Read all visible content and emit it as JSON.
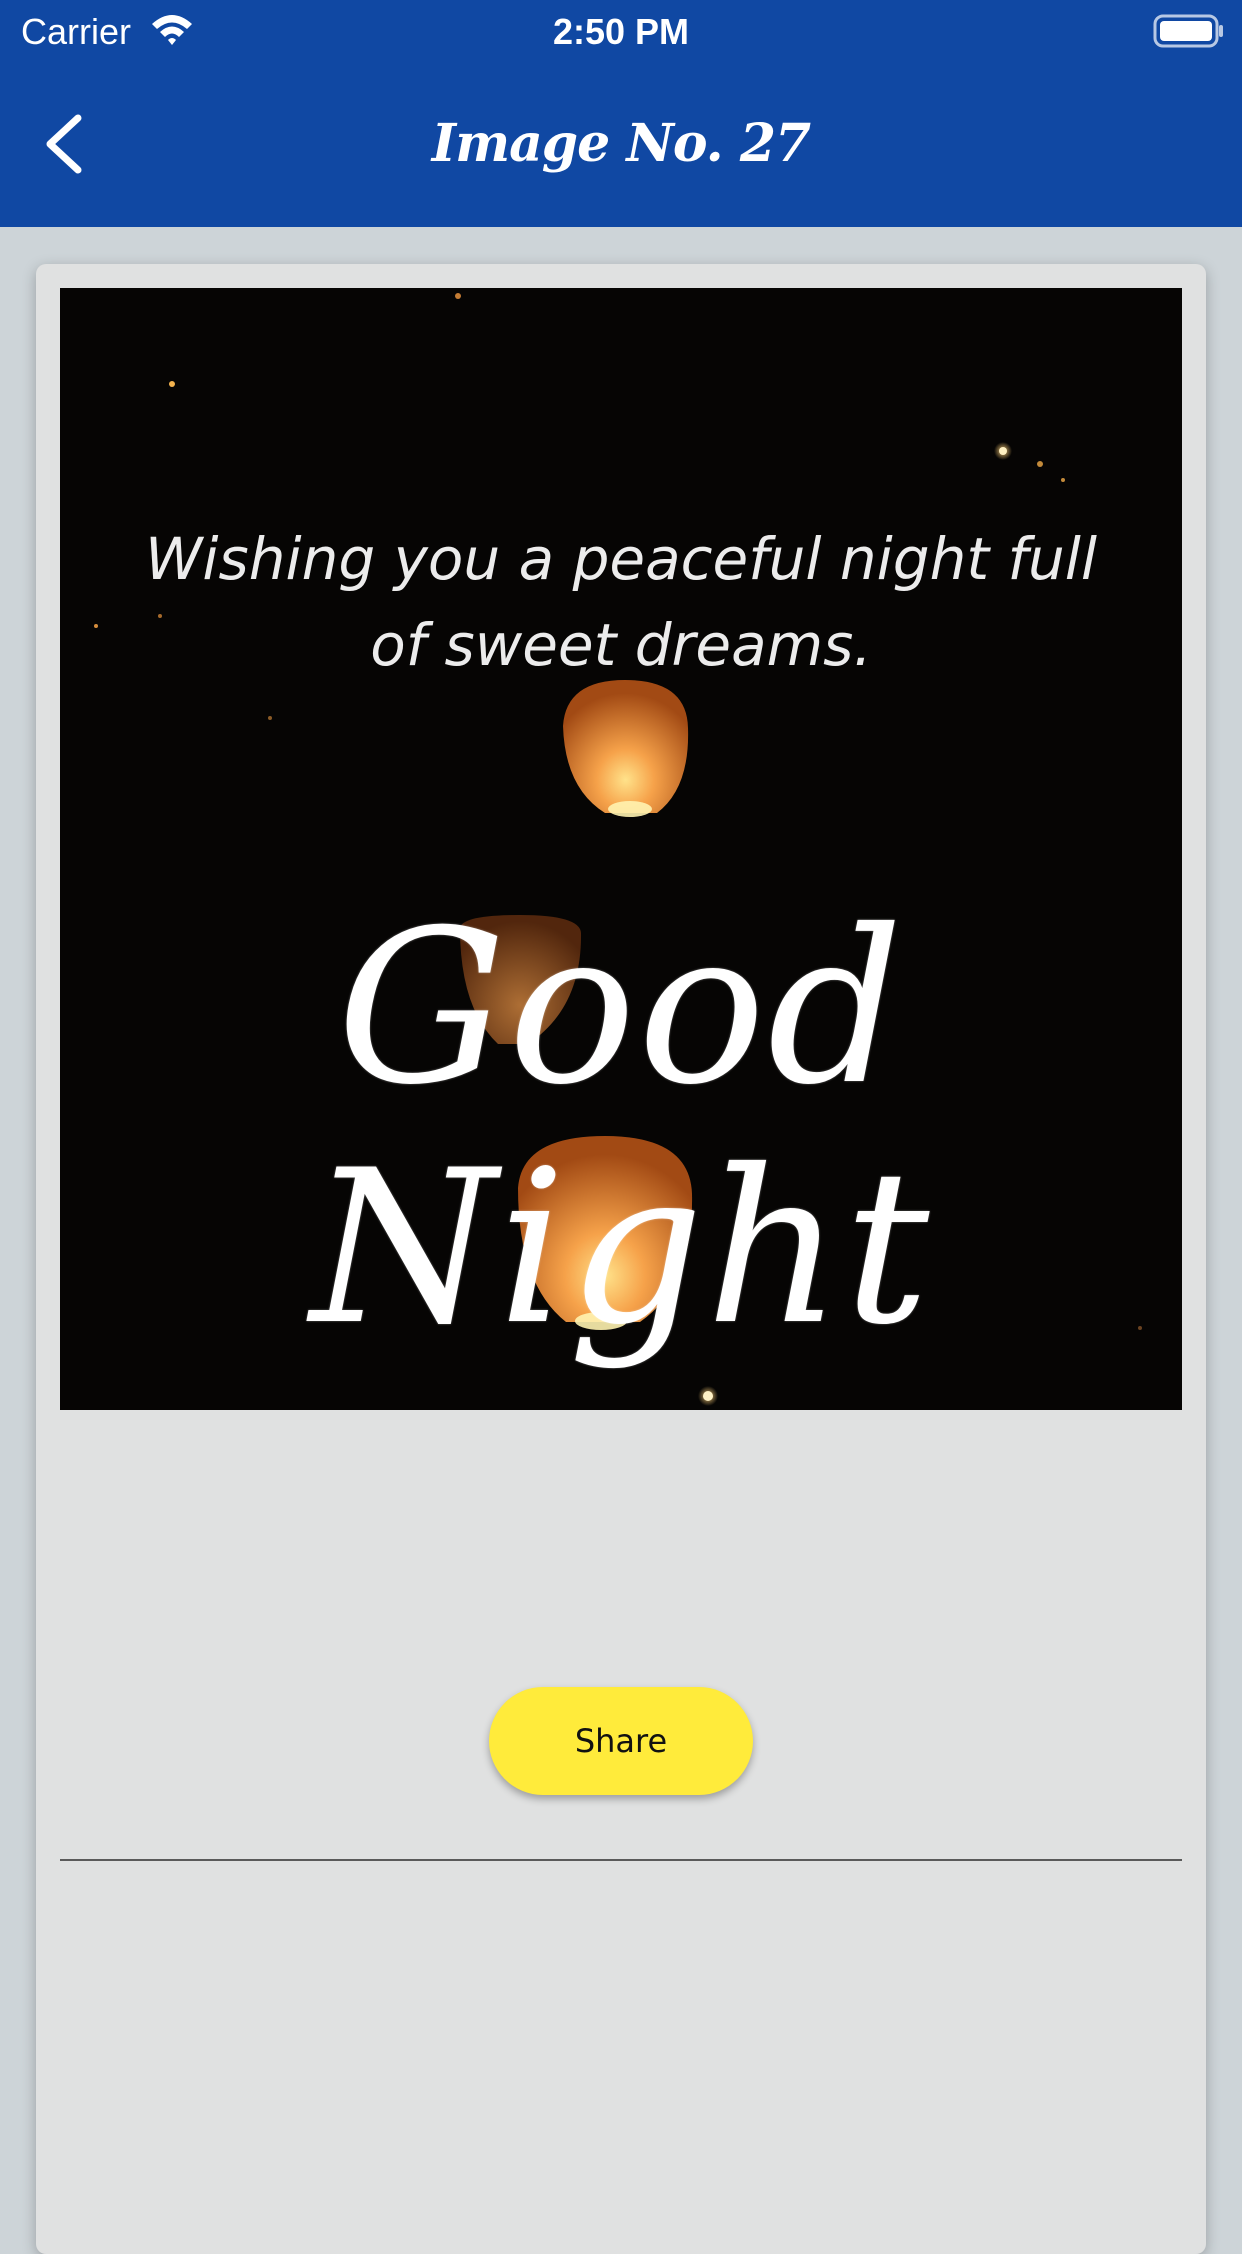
{
  "status_bar": {
    "carrier": "Carrier",
    "time": "2:50 PM",
    "wifi_icon": "wifi-icon",
    "battery_icon": "battery-icon"
  },
  "header": {
    "title": "Image No. 27",
    "back_icon": "chevron-left-icon",
    "background_color": "#1048a3"
  },
  "image": {
    "message_line": "Wishing you a peaceful night full\nof sweet dreams.",
    "headline": "Good Night"
  },
  "actions": {
    "share_label": "Share",
    "share_color": "#ffeb3b"
  }
}
